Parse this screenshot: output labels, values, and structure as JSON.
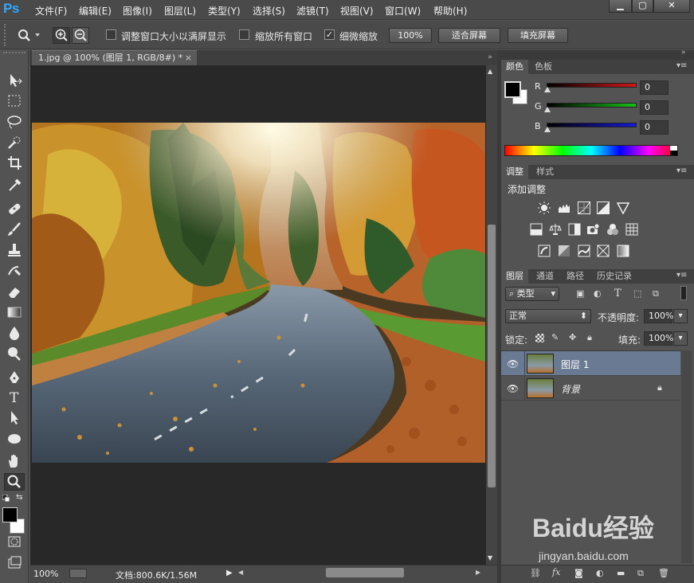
{
  "app": {
    "logo": "Ps"
  },
  "menu": [
    "文件(F)",
    "编辑(E)",
    "图像(I)",
    "图层(L)",
    "类型(Y)",
    "选择(S)",
    "滤镜(T)",
    "视图(V)",
    "窗口(W)",
    "帮助(H)"
  ],
  "window_controls": {
    "minimize": "▁",
    "restore": "▢",
    "close": "✕"
  },
  "options": {
    "resize_windows": "调整窗口大小以满屏显示",
    "resize_checked": false,
    "zoom_all": "缩放所有窗口",
    "zoom_all_checked": false,
    "scrubby": "细微缩放",
    "scrubby_checked": true,
    "btn_100": "100%",
    "btn_fit": "适合屏幕",
    "btn_fill": "填充屏幕"
  },
  "document": {
    "tab_title": "1.jpg @ 100% (图层 1, RGB/8#) *",
    "tab_close": "×",
    "zoom": "100%",
    "doc_info": "文档:800.6K/1.56M"
  },
  "color_panel": {
    "tabs": [
      "颜色",
      "色板"
    ],
    "channels": [
      {
        "label": "R",
        "value": "0",
        "color": "#d01818"
      },
      {
        "label": "G",
        "value": "0",
        "color": "#18c018"
      },
      {
        "label": "B",
        "value": "0",
        "color": "#1818d8"
      }
    ]
  },
  "adjust_panel": {
    "tabs": [
      "调整",
      "样式"
    ],
    "title": "添加调整"
  },
  "layers_panel": {
    "tabs": [
      "图层",
      "通道",
      "路径",
      "历史记录"
    ],
    "filter_kind": "类型",
    "blend_mode": "正常",
    "opacity_label": "不透明度:",
    "opacity": "100%",
    "lock_label": "锁定:",
    "fill_label": "填充:",
    "fill": "100%",
    "layers": [
      {
        "name": "图层 1",
        "selected": true,
        "locked": false
      },
      {
        "name": "背景",
        "selected": false,
        "locked": true
      }
    ]
  },
  "watermark": {
    "brand": "Baidu经验",
    "url": "jingyan.baidu.com"
  }
}
